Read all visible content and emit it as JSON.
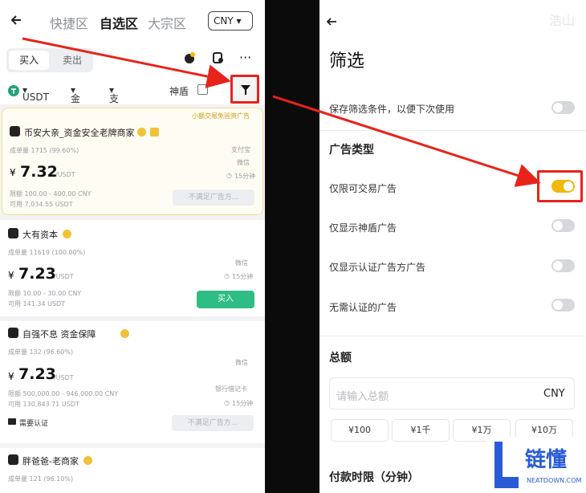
{
  "left": {
    "tabs": [
      "快捷区",
      "自选区",
      "大宗区"
    ],
    "currency": "CNY",
    "buy_tab": "买入",
    "sell_tab": "卖出",
    "filters": {
      "coin": "USDT",
      "amount": "金额",
      "payment": "支付方式",
      "shield": "神盾"
    },
    "card1": {
      "tag": "小额交易免验资广告",
      "merchant": "币安大亲_资金安全老牌商家",
      "orders": "成单量 1715 (99.60%)",
      "pay1": "支付宝",
      "pay2": "微信",
      "time": "15分钟",
      "price_prefix": "¥",
      "price": "7.32",
      "unit": "/USDT",
      "limit": "限额 100.00 - 400.00 CNY",
      "available": "可用 7,034.55 USDT",
      "action": "不满足广告方..."
    },
    "card2": {
      "merchant": "大有资本",
      "orders": "成单量 11619 (100.00%)",
      "pay1": "微信",
      "time": "15分钟",
      "price_prefix": "¥",
      "price": "7.23",
      "unit": "/USDT",
      "limit": "限额 10.00 - 30.00 CNY",
      "available": "可用 141.34 USDT",
      "action": "买入"
    },
    "card3": {
      "merchant": "自强不息 资金保障",
      "orders": "成单量 132 (96.60%)",
      "pay1": "微信",
      "pay2": "银行借记卡",
      "time": "15分钟",
      "price_prefix": "¥",
      "price": "7.23",
      "unit": "/USDT",
      "limit": "限额 500,000.00 - 946,000.00 CNY",
      "available": "可用 130,843.71 USDT",
      "verify": "需要认证",
      "action": "不满足广告方..."
    },
    "card4": {
      "merchant": "胖爸爸-老商家",
      "orders": "成单量 121 (96.10%)"
    }
  },
  "right": {
    "title": "筛选",
    "save_label": "保存筛选条件，以便下次使用",
    "ad_type_head": "广告类型",
    "opt1": "仅限可交易广告",
    "opt2": "仅显示神盾广告",
    "opt3": "仅显示认证广告方广告",
    "opt4": "无需认证的广告",
    "total_head": "总额",
    "amount_placeholder": "请输入总额",
    "amount_currency": "CNY",
    "chips": [
      "¥100",
      "¥1千",
      "¥1万",
      "¥10万"
    ],
    "pay_time_head": "付款时限（分钟）",
    "toggles": {
      "save": false,
      "opt1": true,
      "opt2": false,
      "opt3": false,
      "opt4": false
    }
  },
  "watermark": {
    "cn": "链懂",
    "en": "NEATDOWN.COM"
  },
  "corner_mark": "浩山",
  "colors": {
    "accent": "#f0b90b",
    "green": "#2ebd85",
    "annotation_red": "#e8231b"
  }
}
